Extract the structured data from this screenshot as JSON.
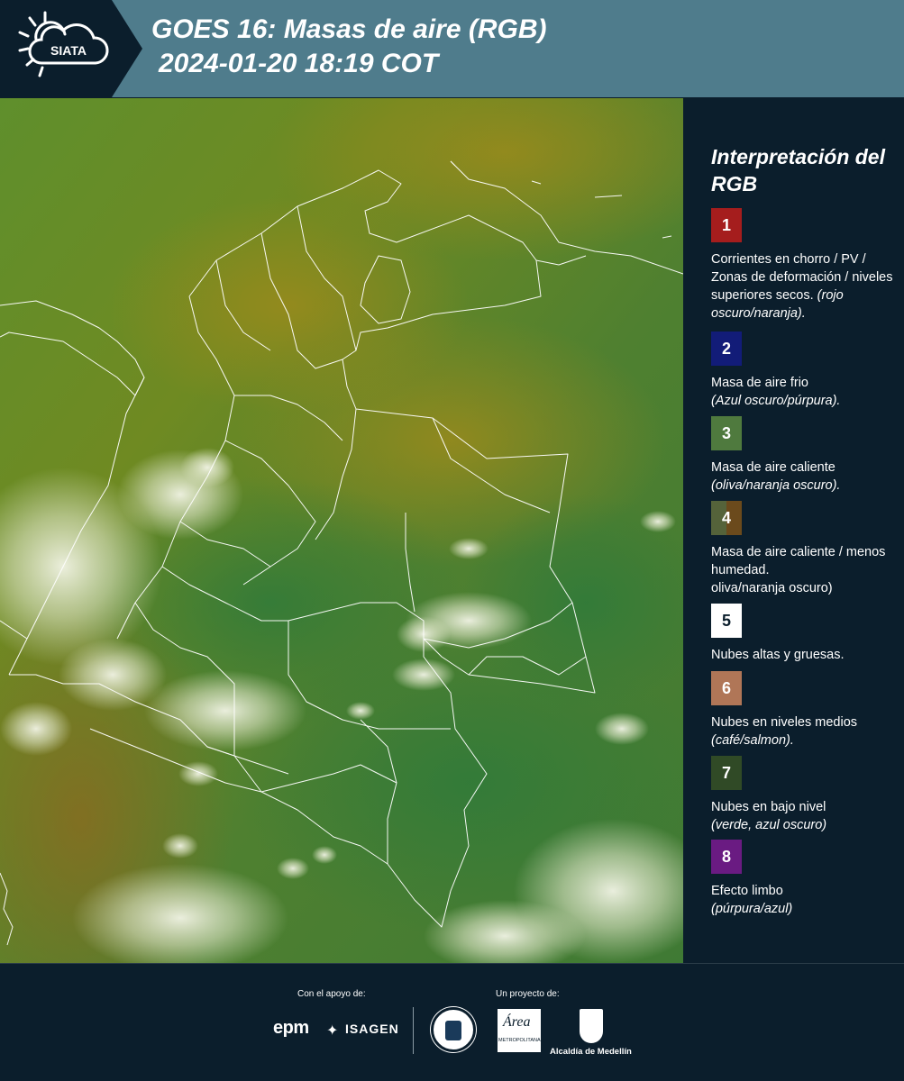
{
  "header": {
    "logo_text": "SIATA",
    "title_line1": "GOES 16: Masas de aire (RGB)",
    "title_line2": "2024-01-20 18:19 COT"
  },
  "panel": {
    "title": "Interpretación del RGB",
    "items": [
      {
        "number": "1",
        "color": "#a51d1d",
        "number_color": "#ffffff",
        "text": "Corrientes en chorro / PV / Zonas de deformación / niveles superiores secos.",
        "note": "(rojo oscuro/naranja)."
      },
      {
        "number": "2",
        "color": "#121c78",
        "number_color": "#ffffff",
        "text": "Masa de aire frio",
        "note": "(Azul oscuro/púrpura)."
      },
      {
        "number": "3",
        "color": "#4f7a3e",
        "number_color": "#ffffff",
        "text": "Masa de aire caliente",
        "note": "(oliva/naranja oscuro)."
      },
      {
        "number": "4",
        "color": "#6d5a2c",
        "number_color": "#ffffff",
        "text": "Masa de aire caliente / menos humedad.",
        "note": "oliva/naranja oscuro)"
      },
      {
        "number": "5",
        "color": "#ffffff",
        "number_color": "#0b1e2c",
        "text": "Nubes altas y gruesas.",
        "note": ""
      },
      {
        "number": "6",
        "color": "#b07657",
        "number_color": "#ffffff",
        "text": "Nubes en niveles medios",
        "note": "(café/salmon)."
      },
      {
        "number": "7",
        "color": "#304a26",
        "number_color": "#ffffff",
        "text": "Nubes en bajo nivel",
        "note": "(verde, azul oscuro)"
      },
      {
        "number": "8",
        "color": "#6a1b82",
        "number_color": "#ffffff",
        "text": "Efecto limbo",
        "note": "(púrpura/azul)"
      }
    ]
  },
  "footer": {
    "support_label": "Con el apoyo de:",
    "project_label": "Un proyecto de:",
    "epm_text": "epm",
    "isagen_text": "ISAGEN",
    "metropolitana_text": "METROPOLITANA",
    "alcaldia_text": "Alcaldía de Medellín"
  }
}
